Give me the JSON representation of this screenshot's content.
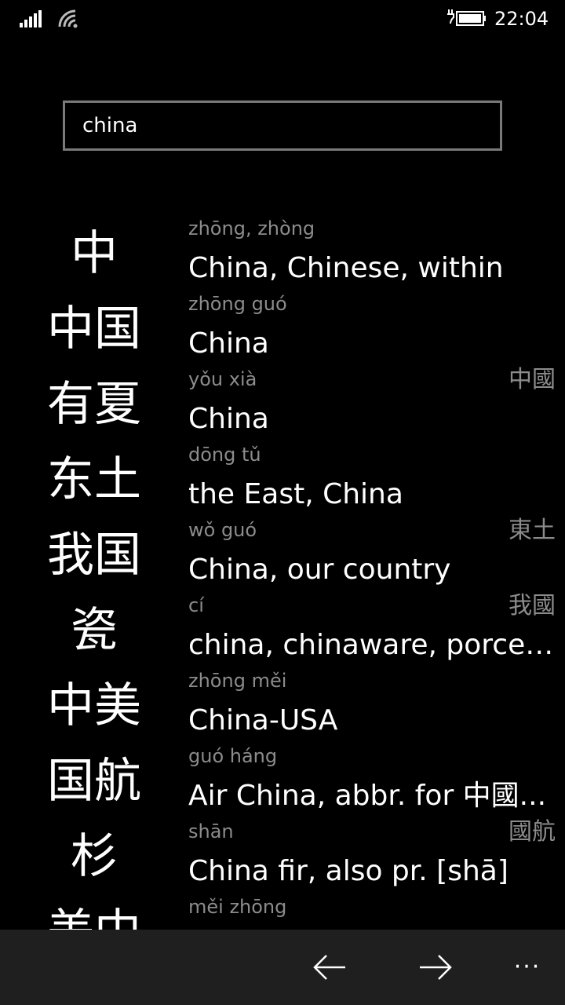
{
  "status_bar": {
    "time": "22:04",
    "icons": [
      "signal-icon",
      "wifi-icon",
      "battery-charging-icon"
    ]
  },
  "search": {
    "value": "china"
  },
  "results": [
    {
      "hanzi": "中",
      "pinyin": "zhōng, zhòng",
      "meaning": "China, Chinese, within",
      "traditional": ""
    },
    {
      "hanzi": "中国",
      "pinyin": "zhōng guó",
      "meaning": "China",
      "traditional": "中國"
    },
    {
      "hanzi": "有夏",
      "pinyin": "yǒu xià",
      "meaning": "China",
      "traditional": ""
    },
    {
      "hanzi": "东土",
      "pinyin": "dōng tǔ",
      "meaning": "the East, China",
      "traditional": "東土"
    },
    {
      "hanzi": "我国",
      "pinyin": "wǒ guó",
      "meaning": "China, our country",
      "traditional": "我國"
    },
    {
      "hanzi": "瓷",
      "pinyin": "cí",
      "meaning": "china, chinaware, porcelain",
      "traditional": ""
    },
    {
      "hanzi": "中美",
      "pinyin": "zhōng měi",
      "meaning": "China-USA",
      "traditional": ""
    },
    {
      "hanzi": "国航",
      "pinyin": "guó háng",
      "meaning": "Air China, abbr. for 中國...",
      "traditional": "國航"
    },
    {
      "hanzi": "杉",
      "pinyin": "shān",
      "meaning": "China fir, also pr. [shā]",
      "traditional": ""
    },
    {
      "hanzi": "美中",
      "pinyin": "měi zhōng",
      "meaning": "",
      "traditional": ""
    }
  ],
  "app_bar": {
    "buttons": [
      "back-arrow-icon",
      "forward-arrow-icon",
      "more-icon"
    ],
    "more_label": "···"
  },
  "colors": {
    "background": "#000000",
    "secondary_text": "#8c8c8c",
    "app_bar": "#1f1f1f",
    "search_border": "#7a7a7a"
  }
}
